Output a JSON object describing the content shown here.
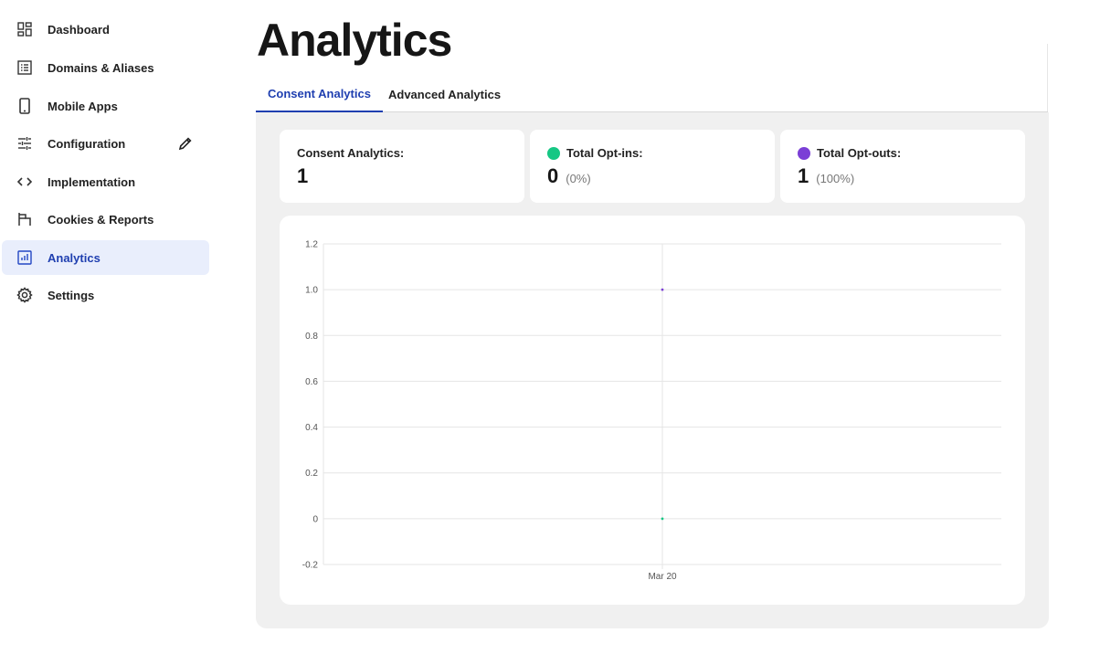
{
  "sidebar": {
    "items": [
      {
        "label": "Dashboard",
        "icon": "dashboard-icon"
      },
      {
        "label": "Domains & Aliases",
        "icon": "list-icon"
      },
      {
        "label": "Mobile Apps",
        "icon": "phone-icon"
      },
      {
        "label": "Configuration",
        "icon": "sliders-icon"
      },
      {
        "label": "Implementation",
        "icon": "code-icon"
      },
      {
        "label": "Cookies & Reports",
        "icon": "flag-icon"
      },
      {
        "label": "Analytics",
        "icon": "chart-icon"
      },
      {
        "label": "Settings",
        "icon": "gear-icon"
      }
    ],
    "active": "Analytics",
    "accent": "#1f3fb0"
  },
  "header": {
    "title": "Analytics"
  },
  "tabs": [
    {
      "label": "Consent Analytics",
      "active": true
    },
    {
      "label": "Advanced Analytics",
      "active": false
    }
  ],
  "cards": {
    "consent": {
      "label": "Consent Analytics:",
      "value": "1"
    },
    "optins": {
      "label": "Total Opt-ins:",
      "value": "0",
      "pct": "(0%)",
      "color": "#16c784"
    },
    "optouts": {
      "label": "Total Opt-outs:",
      "value": "1",
      "pct": "(100%)",
      "color": "#7b3fd6"
    }
  },
  "chart_data": {
    "type": "line",
    "categories": [
      "Mar 20"
    ],
    "series": [
      {
        "values": [
          1
        ],
        "color": "#7b3fd6"
      },
      {
        "values": [
          0
        ],
        "color": "#16c784"
      }
    ],
    "ylim": [
      -0.2,
      1.2
    ],
    "yticks": [
      "-0.2",
      "0",
      "0.2",
      "0.4",
      "0.6",
      "0.8",
      "1.0",
      "1.2"
    ],
    "grid": true
  }
}
